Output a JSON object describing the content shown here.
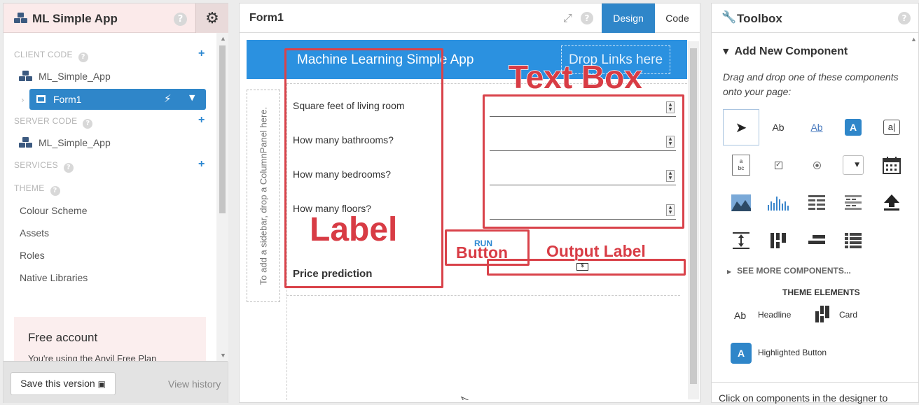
{
  "left": {
    "title": "ML Simple App",
    "help": "?",
    "settings_icon": "gear-icon",
    "client_code_label": "CLIENT CODE",
    "client_app_item": "ML_Simple_App",
    "form_item": "Form1",
    "server_code_label": "SERVER CODE",
    "server_app_item": "ML_Simple_App",
    "services_label": "SERVICES",
    "theme_label": "THEME",
    "theme_items": [
      "Colour Scheme",
      "Assets",
      "Roles",
      "Native Libraries"
    ],
    "free_account_title": "Free account",
    "free_account_text": "You're using the Anvil Free Plan",
    "save_button": "Save this version",
    "view_history": "View history"
  },
  "center": {
    "title": "Form1",
    "tab_design": "Design",
    "tab_code": "Code",
    "app_title": "Machine Learning Simple App",
    "drop_links": "Drop Links here",
    "sidebar_hint": "To add a sidebar, drop a ColumnPanel here.",
    "labels": [
      "Square feet of living room",
      "How many bathrooms?",
      "How many bedrooms?",
      "How many floors?"
    ],
    "run_button": "RUN",
    "price_label": "Price prediction",
    "annotations": {
      "text_box": "Text Box",
      "label": "Label",
      "button": "Button",
      "output_label": "Output Label"
    },
    "annotation_color": "#d9424a",
    "accent": "#2b91e0"
  },
  "right": {
    "title": "Toolbox",
    "help": "?",
    "add_new": "Add New Component",
    "drag_tip": "Drag and drop one of these components onto your page:",
    "component_text": {
      "label": "Ab",
      "link": "Ab",
      "button": "A",
      "textbox": "a|"
    },
    "see_more": "SEE MORE COMPONENTS...",
    "theme_elements": "THEME ELEMENTS",
    "headline_icon": "Ab",
    "headline": "Headline",
    "card": "Card",
    "highlighted_button_icon": "A",
    "highlighted_button": "Highlighted Button",
    "footer_text": "Click on components in the designer to"
  }
}
